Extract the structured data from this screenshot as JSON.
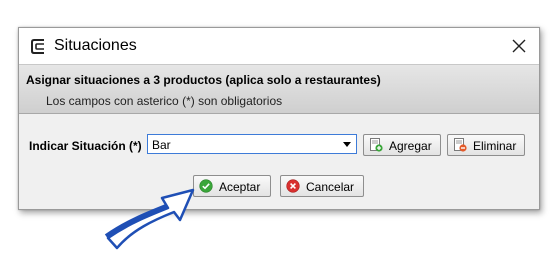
{
  "window": {
    "title": "Situaciones",
    "app_icon": "app-logo-icon",
    "close_icon": "close-icon"
  },
  "header": {
    "title": "Asignar situaciones a 3 productos  (aplica solo a restaurantes)",
    "subtitle": "Los campos con asterico (*) son obligatorios"
  },
  "form": {
    "situation_label": "Indicar Situación (*)",
    "situation_value": "Bar",
    "add_label": "Agregar",
    "add_icon": "add-document-icon",
    "remove_label": "Eliminar",
    "remove_icon": "remove-document-icon"
  },
  "actions": {
    "accept_label": "Aceptar",
    "accept_icon": "check-circle-icon",
    "cancel_label": "Cancelar",
    "cancel_icon": "cancel-x-icon"
  },
  "colors": {
    "accent": "#3d7bd8",
    "ok_green": "#3aa63a",
    "cancel_red": "#d9302f",
    "arrow_blue": "#1f4fb5"
  }
}
